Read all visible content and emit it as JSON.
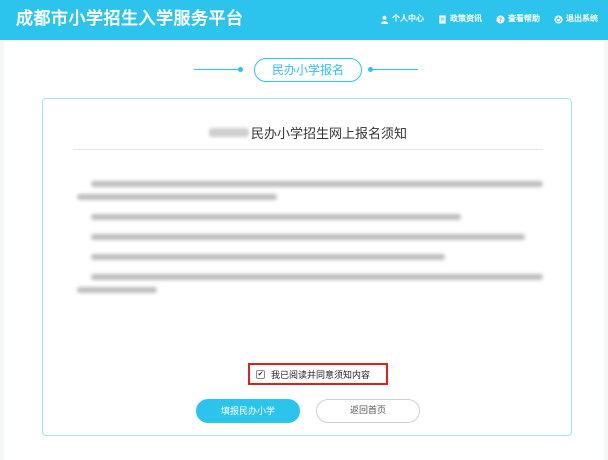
{
  "header": {
    "title": "成都市小学招生入学服务平台",
    "nav": [
      {
        "label": "个人中心",
        "icon": "user-icon"
      },
      {
        "label": "政策资讯",
        "icon": "document-icon"
      },
      {
        "label": "查看帮助",
        "icon": "help-icon"
      },
      {
        "label": "退出系统",
        "icon": "logout-icon"
      }
    ]
  },
  "section": {
    "title": "民办小学报名"
  },
  "notice": {
    "title_suffix": "民办小学招生网上报名须知"
  },
  "agreement": {
    "label": "我已阅读并同意须知内容",
    "checked": true,
    "check_mark": "✔"
  },
  "buttons": {
    "fill": "填报民办小学",
    "home": "返回首页"
  },
  "colors": {
    "accent": "#2cc4ec",
    "highlight_border": "#e02020"
  }
}
